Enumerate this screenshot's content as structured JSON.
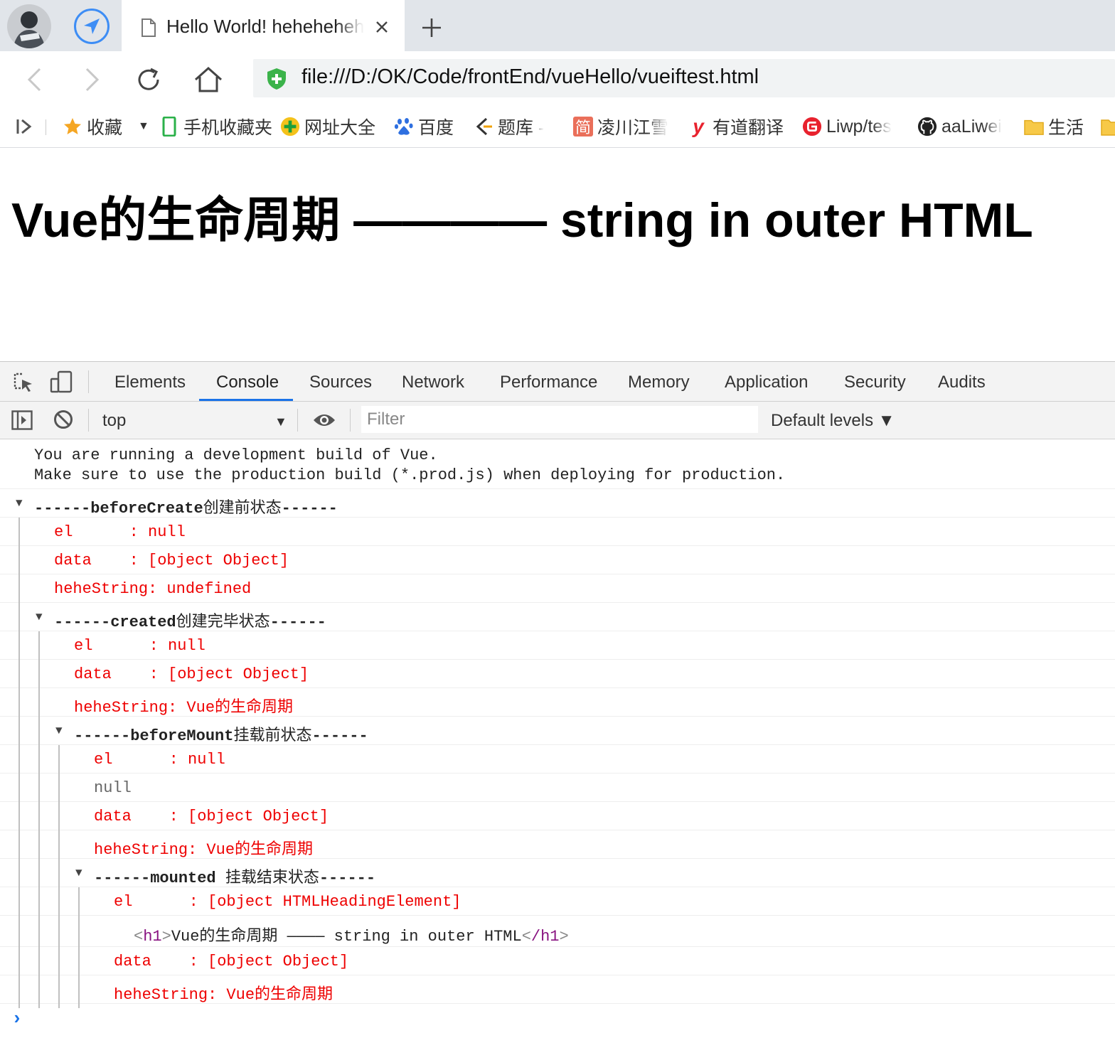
{
  "browser": {
    "tab_title": "Hello World! hehehehehe",
    "url": "file:///D:/OK/Code/frontEnd/vueHello/vueiftest.html",
    "icons": {
      "avatar": "avatar",
      "send": "send-arrow-icon",
      "page": "page-icon",
      "close": "close-icon",
      "new_tab": "plus-icon",
      "back": "back-icon",
      "forward": "forward-icon",
      "reload": "reload-icon",
      "home": "home-icon",
      "secure": "shield-icon"
    }
  },
  "bookmarks": [
    {
      "label": "收藏",
      "icon": "star-icon"
    },
    {
      "label": "手机收藏夹",
      "icon": "phone-icon"
    },
    {
      "label": "网址大全",
      "icon": "plus-circle-icon"
    },
    {
      "label": "百度",
      "icon": "baidu-paw-icon"
    },
    {
      "label": "题库 -",
      "icon": "bracket-icon"
    },
    {
      "label": "凌川江雪",
      "icon": "jianshu-icon"
    },
    {
      "label": "有道翻译",
      "icon": "youdao-icon"
    },
    {
      "label": "Liwp/tes",
      "icon": "gitee-icon"
    },
    {
      "label": "aaLiwei",
      "icon": "github-icon"
    },
    {
      "label": "生活",
      "icon": "folder-icon"
    }
  ],
  "page": {
    "heading": "Vue的生命周期 ———— string in outer HTML"
  },
  "devtools": {
    "tabs": [
      "Elements",
      "Console",
      "Sources",
      "Network",
      "Performance",
      "Memory",
      "Application",
      "Security",
      "Audits"
    ],
    "active_tab": "Console",
    "context": "top",
    "filter_placeholder": "Filter",
    "levels": "Default levels ▼",
    "accent": "#1a73e8",
    "messages": {
      "dev_line1": "You are running a development build of Vue.",
      "dev_line2": "Make sure to use the production build (*.prod.js) when deploying for production.",
      "g1_dashes_a": "------",
      "g1_name": "beforeCreate",
      "g1_cjk": "创建前状态",
      "g1_dashes_b": "------",
      "g1_el": "el      : null",
      "g1_data": "data    : [object Object]",
      "g1_str": "heheString: undefined",
      "g2_dashes_a": "------",
      "g2_name": "created",
      "g2_cjk": "创建完毕状态",
      "g2_dashes_b": "------",
      "g2_el": "el      : null",
      "g2_data": "data    : [object Object]",
      "g2_str": "heheString: Vue的生命周期",
      "g3_dashes_a": "------",
      "g3_name": "beforeMount",
      "g3_cjk": "挂载前状态",
      "g3_dashes_b": "------",
      "g3_el": "el      : null",
      "g3_null": "null",
      "g3_data": "data    : [object Object]",
      "g3_str": "heheString: Vue的生命周期",
      "g4_dashes_a": "------",
      "g4_name": "mounted ",
      "g4_cjk": "挂载结束状态",
      "g4_dashes_b": "------",
      "g4_el": "el      : [object HTMLHeadingElement]",
      "g4_tag_open": "h1",
      "g4_html_text": "Vue的生命周期 ———— string in outer HTML",
      "g4_tag_close": "/h1",
      "g4_data": "data    : [object Object]",
      "g4_str": "heheString: Vue的生命周期"
    }
  }
}
